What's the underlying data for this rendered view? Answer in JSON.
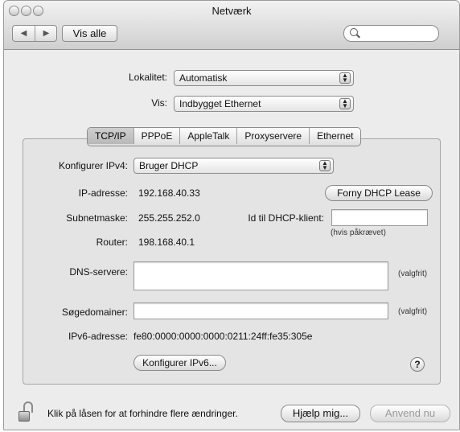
{
  "window": {
    "title": "Netværk"
  },
  "toolbar": {
    "back_glyph": "◀",
    "forward_glyph": "▶",
    "show_all_label": "Vis alle",
    "search_placeholder": ""
  },
  "location": {
    "label": "Lokalitet:",
    "value": "Automatisk"
  },
  "show": {
    "label": "Vis:",
    "value": "Indbygget Ethernet"
  },
  "tabs": [
    {
      "label": "TCP/IP",
      "active": true
    },
    {
      "label": "PPPoE",
      "active": false
    },
    {
      "label": "AppleTalk",
      "active": false
    },
    {
      "label": "Proxyservere",
      "active": false
    },
    {
      "label": "Ethernet",
      "active": false
    }
  ],
  "tcpip": {
    "configure_ipv4_label": "Konfigurer IPv4:",
    "configure_ipv4_value": "Bruger DHCP",
    "ip_label": "IP-adresse:",
    "ip_value": "192.168.40.33",
    "renew_button": "Forny DHCP Lease",
    "subnet_label": "Subnetmaske:",
    "subnet_value": "255.255.252.0",
    "client_id_label": "Id til DHCP-klient:",
    "client_id_value": "",
    "client_id_hint": "(hvis påkrævet)",
    "router_label": "Router:",
    "router_value": "198.168.40.1",
    "dns_label": "DNS-servere:",
    "dns_value": "",
    "dns_hint": "(valgfrit)",
    "search_domains_label": "Søgedomainer:",
    "search_domains_value": "",
    "search_domains_hint": "(valgfrit)",
    "ipv6_label": "IPv6-adresse:",
    "ipv6_value": "fe80:0000:0000:0000:0211:24ff:fe35:305e",
    "configure_ipv6_button": "Konfigurer IPv6...",
    "help_glyph": "?"
  },
  "footer": {
    "lock_text": "Klik på låsen for at forhindre flere ændringer.",
    "assist_button": "Hjælp mig...",
    "apply_button": "Anvend nu"
  }
}
